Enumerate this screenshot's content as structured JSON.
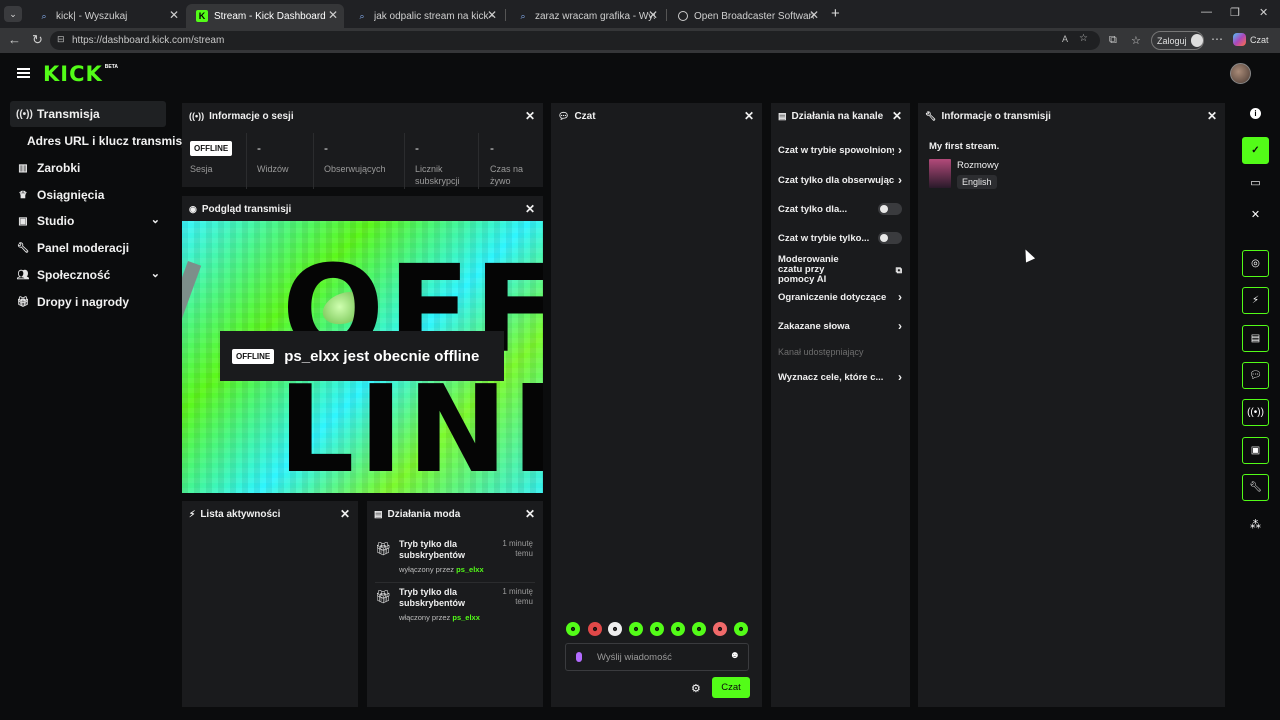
{
  "browser": {
    "tabs": [
      {
        "label": "kick| - Wyszukaj",
        "icon": "search-icon"
      },
      {
        "label": "Stream - Kick Dashboard",
        "icon": "kick-icon"
      },
      {
        "label": "jak odpalic stream na kick - Wyszu",
        "icon": "search-icon"
      },
      {
        "label": "zaraz wracam grafika - Wyszukaj G",
        "icon": "search-icon"
      },
      {
        "label": "Open Broadcaster Software | OBS",
        "icon": "globe-icon"
      }
    ],
    "url": "https://dashboard.kick.com/stream",
    "login_label": "Zaloguj",
    "copilot_label": "Czat"
  },
  "logo": {
    "text": "KICK",
    "badge": "BETA"
  },
  "sidebar": {
    "items": [
      {
        "label": "Transmisja",
        "icon": "broadcast-icon"
      },
      {
        "label": "Adres URL i klucz transmisji",
        "icon": ""
      },
      {
        "label": "Zarobki",
        "icon": "chart-icon"
      },
      {
        "label": "Osiągnięcia",
        "icon": "trophy-icon"
      },
      {
        "label": "Studio",
        "icon": "layout-icon"
      },
      {
        "label": "Panel moderacji",
        "icon": "wrench-icon"
      },
      {
        "label": "Społeczność",
        "icon": "people-icon"
      },
      {
        "label": "Dropy i nagrody",
        "icon": "gift-icon"
      }
    ]
  },
  "session": {
    "title": "Informacje o sesji",
    "badge": "OFFLINE",
    "stats": [
      {
        "label": "Sesja",
        "value": ""
      },
      {
        "label": "Widzów",
        "value": "-"
      },
      {
        "label": "Obserwujących",
        "value": "-"
      },
      {
        "label": "Licznik subskrypcji",
        "value": "-"
      },
      {
        "label": "Czas na żywo",
        "value": "-"
      }
    ]
  },
  "preview": {
    "title": "Podgląd transmisji",
    "badge": "OFFLINE",
    "message": "ps_elxx jest obecnie offline",
    "bg_text_top": "OFF",
    "bg_text_bottom": "LINE"
  },
  "activity": {
    "title": "Lista aktywności"
  },
  "modactions": {
    "title": "Działania moda",
    "entries": [
      {
        "title": "Tryb tylko dla subskrybentów",
        "time": "1 minutę temu",
        "action": "wyłączony przez",
        "user": "ps_elxx"
      },
      {
        "title": "Tryb tylko dla subskrybentów",
        "time": "1 minutę temu",
        "action": "włączony przez",
        "user": "ps_elxx"
      }
    ]
  },
  "chat": {
    "title": "Czat",
    "placeholder": "Wyślij wiadomość",
    "send_label": "Czat",
    "emotes": [
      "emote-1",
      "emote-2",
      "emote-3",
      "emote-4",
      "emote-5",
      "emote-6",
      "emote-7",
      "emote-8",
      "emote-9"
    ]
  },
  "channel": {
    "title": "Działania na kanale",
    "items": [
      {
        "label": "Czat w trybie spowolnionym",
        "control": "chevron"
      },
      {
        "label": "Czat tylko dla obserwujących",
        "control": "chevron"
      },
      {
        "label": "Czat tylko dla...",
        "control": "toggle"
      },
      {
        "label": "Czat w trybie tylko...",
        "control": "toggle"
      },
      {
        "label": "Moderowanie czatu przy pomocy AI",
        "control": "external"
      },
      {
        "label": "Ograniczenie dotyczące",
        "control": "chevron"
      },
      {
        "label": "Zakazane słowa",
        "control": "chevron"
      },
      {
        "label": "Kanał udostępniający",
        "control": "none"
      },
      {
        "label": "Wyznacz cele, które c...",
        "control": "chevron"
      }
    ]
  },
  "streaminfo": {
    "title": "Informacje o transmisji",
    "stream_title": "My first stream.",
    "category": "Rozmowy",
    "language": "English"
  },
  "colors": {
    "accent": "#53fc18",
    "panel": "#1a1b1d",
    "bg": "#0b0c0d"
  }
}
